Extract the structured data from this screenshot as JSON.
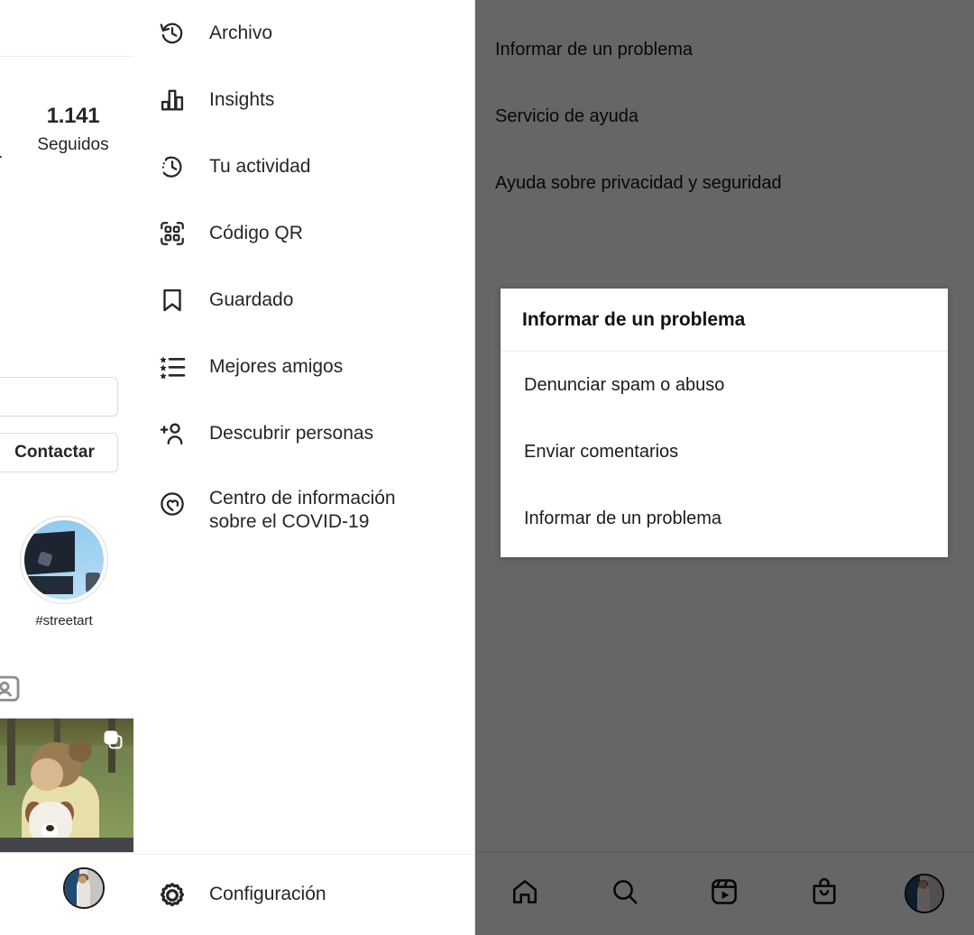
{
  "app": {
    "name": "instagram-profile",
    "language": "es"
  },
  "profile_sliver": {
    "stat": {
      "previous_partial": ".",
      "value": "1.141",
      "label": "Seguidos"
    },
    "buttons": [
      {
        "name": "edit-profile-button",
        "label": ""
      },
      {
        "name": "contact-button",
        "label": "Contactar"
      }
    ],
    "highlight": {
      "label": "#streetart",
      "icon": "story-highlight-thumbnail"
    },
    "tagged_icon": "tagged-photos-icon",
    "grid_post": {
      "icon": "multiple-photos-icon",
      "alt": "woman-with-dog-photo"
    },
    "avatar": "profile-avatar"
  },
  "side_menu": {
    "items": [
      {
        "label": "Archivo",
        "icon": "archive-clock-icon"
      },
      {
        "label": "Insights",
        "icon": "bar-chart-icon"
      },
      {
        "label": "Tu actividad",
        "icon": "activity-clock-icon"
      },
      {
        "label": "Código QR",
        "icon": "qr-code-icon"
      },
      {
        "label": "Guardado",
        "icon": "bookmark-icon"
      },
      {
        "label": "Mejores amigos",
        "icon": "star-list-icon"
      },
      {
        "label": "Descubrir personas",
        "icon": "add-person-icon"
      },
      {
        "label": "Centro de información sobre el COVID-19",
        "icon": "covid-heart-icon"
      }
    ],
    "settings": {
      "label": "Configuración",
      "icon": "gear-icon"
    }
  },
  "help_screen": {
    "rows": [
      "Informar de un problema",
      "Servicio de ayuda",
      "Ayuda sobre privacidad y seguridad"
    ]
  },
  "report_dialog": {
    "title": "Informar de un problema",
    "options": [
      "Denunciar spam o abuso",
      "Enviar comentarios",
      "Informar de un problema"
    ]
  },
  "bottom_nav": {
    "items": [
      {
        "name": "home",
        "icon": "home-icon"
      },
      {
        "name": "search",
        "icon": "search-icon"
      },
      {
        "name": "reels",
        "icon": "reels-icon"
      },
      {
        "name": "shop",
        "icon": "shopping-bag-icon"
      },
      {
        "name": "profile",
        "icon": "profile-avatar-icon"
      }
    ]
  },
  "colors": {
    "background": "#ffffff",
    "text_primary": "#262626",
    "border": "#dbdbdb",
    "overlay": "#636363",
    "dialog_background": "#ffffff"
  }
}
